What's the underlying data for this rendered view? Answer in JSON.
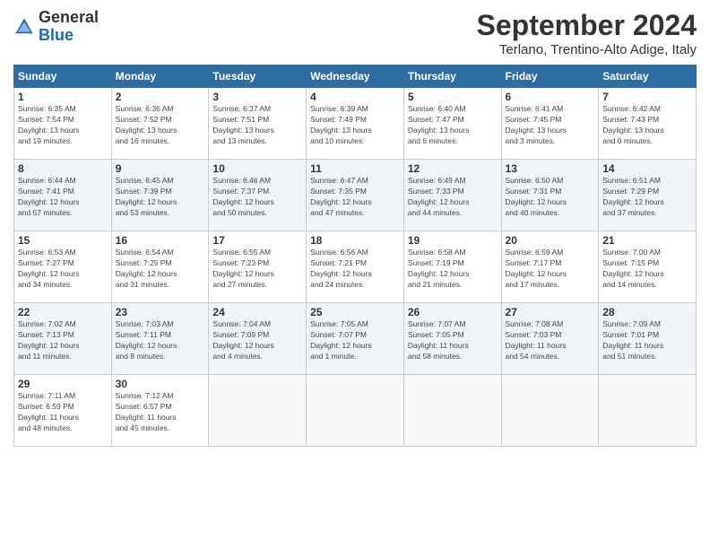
{
  "logo": {
    "general": "General",
    "blue": "Blue"
  },
  "header": {
    "month": "September 2024",
    "location": "Terlano, Trentino-Alto Adige, Italy"
  },
  "weekdays": [
    "Sunday",
    "Monday",
    "Tuesday",
    "Wednesday",
    "Thursday",
    "Friday",
    "Saturday"
  ],
  "weeks": [
    [
      {
        "day": "1",
        "info": "Sunrise: 6:35 AM\nSunset: 7:54 PM\nDaylight: 13 hours\nand 19 minutes."
      },
      {
        "day": "2",
        "info": "Sunrise: 6:36 AM\nSunset: 7:52 PM\nDaylight: 13 hours\nand 16 minutes."
      },
      {
        "day": "3",
        "info": "Sunrise: 6:37 AM\nSunset: 7:51 PM\nDaylight: 13 hours\nand 13 minutes."
      },
      {
        "day": "4",
        "info": "Sunrise: 6:39 AM\nSunset: 7:49 PM\nDaylight: 13 hours\nand 10 minutes."
      },
      {
        "day": "5",
        "info": "Sunrise: 6:40 AM\nSunset: 7:47 PM\nDaylight: 13 hours\nand 6 minutes."
      },
      {
        "day": "6",
        "info": "Sunrise: 6:41 AM\nSunset: 7:45 PM\nDaylight: 13 hours\nand 3 minutes."
      },
      {
        "day": "7",
        "info": "Sunrise: 6:42 AM\nSunset: 7:43 PM\nDaylight: 13 hours\nand 0 minutes."
      }
    ],
    [
      {
        "day": "8",
        "info": "Sunrise: 6:44 AM\nSunset: 7:41 PM\nDaylight: 12 hours\nand 57 minutes."
      },
      {
        "day": "9",
        "info": "Sunrise: 6:45 AM\nSunset: 7:39 PM\nDaylight: 12 hours\nand 53 minutes."
      },
      {
        "day": "10",
        "info": "Sunrise: 6:46 AM\nSunset: 7:37 PM\nDaylight: 12 hours\nand 50 minutes."
      },
      {
        "day": "11",
        "info": "Sunrise: 6:47 AM\nSunset: 7:35 PM\nDaylight: 12 hours\nand 47 minutes."
      },
      {
        "day": "12",
        "info": "Sunrise: 6:49 AM\nSunset: 7:33 PM\nDaylight: 12 hours\nand 44 minutes."
      },
      {
        "day": "13",
        "info": "Sunrise: 6:50 AM\nSunset: 7:31 PM\nDaylight: 12 hours\nand 40 minutes."
      },
      {
        "day": "14",
        "info": "Sunrise: 6:51 AM\nSunset: 7:29 PM\nDaylight: 12 hours\nand 37 minutes."
      }
    ],
    [
      {
        "day": "15",
        "info": "Sunrise: 6:53 AM\nSunset: 7:27 PM\nDaylight: 12 hours\nand 34 minutes."
      },
      {
        "day": "16",
        "info": "Sunrise: 6:54 AM\nSunset: 7:25 PM\nDaylight: 12 hours\nand 31 minutes."
      },
      {
        "day": "17",
        "info": "Sunrise: 6:55 AM\nSunset: 7:23 PM\nDaylight: 12 hours\nand 27 minutes."
      },
      {
        "day": "18",
        "info": "Sunrise: 6:56 AM\nSunset: 7:21 PM\nDaylight: 12 hours\nand 24 minutes."
      },
      {
        "day": "19",
        "info": "Sunrise: 6:58 AM\nSunset: 7:19 PM\nDaylight: 12 hours\nand 21 minutes."
      },
      {
        "day": "20",
        "info": "Sunrise: 6:59 AM\nSunset: 7:17 PM\nDaylight: 12 hours\nand 17 minutes."
      },
      {
        "day": "21",
        "info": "Sunrise: 7:00 AM\nSunset: 7:15 PM\nDaylight: 12 hours\nand 14 minutes."
      }
    ],
    [
      {
        "day": "22",
        "info": "Sunrise: 7:02 AM\nSunset: 7:13 PM\nDaylight: 12 hours\nand 11 minutes."
      },
      {
        "day": "23",
        "info": "Sunrise: 7:03 AM\nSunset: 7:11 PM\nDaylight: 12 hours\nand 8 minutes."
      },
      {
        "day": "24",
        "info": "Sunrise: 7:04 AM\nSunset: 7:09 PM\nDaylight: 12 hours\nand 4 minutes."
      },
      {
        "day": "25",
        "info": "Sunrise: 7:05 AM\nSunset: 7:07 PM\nDaylight: 12 hours\nand 1 minute."
      },
      {
        "day": "26",
        "info": "Sunrise: 7:07 AM\nSunset: 7:05 PM\nDaylight: 11 hours\nand 58 minutes."
      },
      {
        "day": "27",
        "info": "Sunrise: 7:08 AM\nSunset: 7:03 PM\nDaylight: 11 hours\nand 54 minutes."
      },
      {
        "day": "28",
        "info": "Sunrise: 7:09 AM\nSunset: 7:01 PM\nDaylight: 11 hours\nand 51 minutes."
      }
    ],
    [
      {
        "day": "29",
        "info": "Sunrise: 7:11 AM\nSunset: 6:59 PM\nDaylight: 11 hours\nand 48 minutes."
      },
      {
        "day": "30",
        "info": "Sunrise: 7:12 AM\nSunset: 6:57 PM\nDaylight: 11 hours\nand 45 minutes."
      },
      {
        "day": "",
        "info": ""
      },
      {
        "day": "",
        "info": ""
      },
      {
        "day": "",
        "info": ""
      },
      {
        "day": "",
        "info": ""
      },
      {
        "day": "",
        "info": ""
      }
    ]
  ]
}
